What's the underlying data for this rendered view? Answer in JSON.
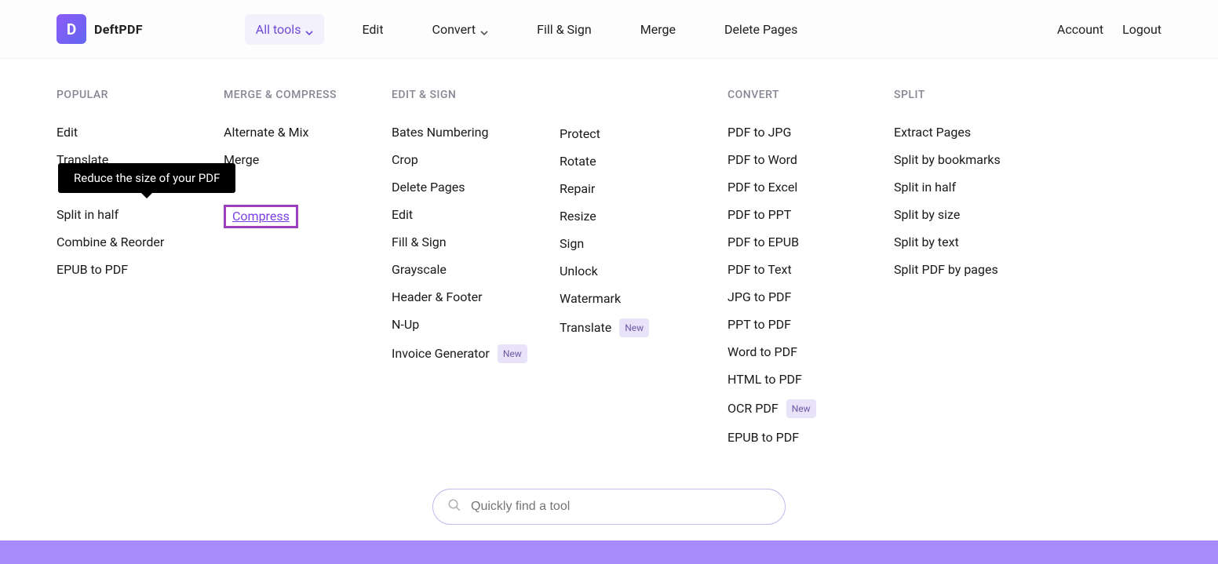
{
  "brand": {
    "initial": "D",
    "name": "DeftPDF"
  },
  "nav": {
    "all_tools": "All tools",
    "edit": "Edit",
    "convert": "Convert",
    "fill_sign": "Fill & Sign",
    "merge": "Merge",
    "delete_pages": "Delete Pages"
  },
  "auth": {
    "account": "Account",
    "logout": "Logout"
  },
  "tooltip": "Reduce the size of your PDF",
  "badge_new": "New",
  "search_placeholder": "Quickly find a tool",
  "columns": {
    "popular": {
      "heading": "POPULAR",
      "items": [
        "Edit",
        "Translate",
        "",
        "Split in half",
        "Combine & Reorder",
        "EPUB to PDF"
      ]
    },
    "merge": {
      "heading": "MERGE & COMPRESS",
      "items": [
        "Alternate & Mix",
        "Merge",
        "",
        "Compress"
      ]
    },
    "edit1": {
      "heading": "EDIT & SIGN",
      "items": [
        "Bates Numbering",
        "Crop",
        "Delete Pages",
        "Edit",
        "Fill & Sign",
        "Grayscale",
        "Header & Footer",
        "N-Up",
        "Invoice Generator"
      ]
    },
    "edit2": {
      "items": [
        "Protect",
        "Rotate",
        "Repair",
        "Resize",
        "Sign",
        "Unlock",
        "Watermark",
        "Translate"
      ]
    },
    "convert": {
      "heading": "CONVERT",
      "items": [
        "PDF to JPG",
        "PDF to Word",
        "PDF to Excel",
        "PDF to PPT",
        "PDF to EPUB",
        "PDF to Text",
        "JPG to PDF",
        "PPT to PDF",
        "Word to PDF",
        "HTML to PDF",
        "OCR PDF",
        "EPUB to PDF"
      ]
    },
    "split": {
      "heading": "SPLIT",
      "items": [
        "Extract Pages",
        "Split by bookmarks",
        "Split in half",
        "Split by size",
        "Split by text",
        "Split PDF by pages"
      ]
    }
  }
}
